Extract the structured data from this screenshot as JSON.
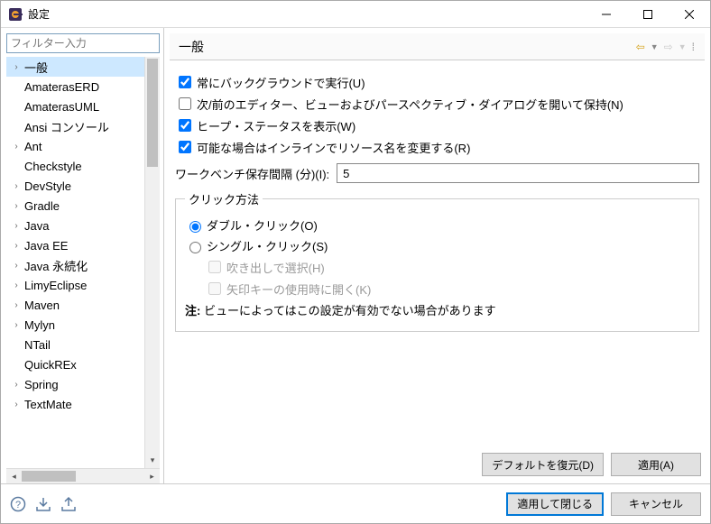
{
  "window": {
    "title": "設定"
  },
  "sidebar": {
    "filter_placeholder": "フィルター入力",
    "items": [
      {
        "label": "一般",
        "expandable": true,
        "selected": true
      },
      {
        "label": "AmaterasERD",
        "expandable": false
      },
      {
        "label": "AmaterasUML",
        "expandable": false
      },
      {
        "label": "Ansi コンソール",
        "expandable": false
      },
      {
        "label": "Ant",
        "expandable": true
      },
      {
        "label": "Checkstyle",
        "expandable": false
      },
      {
        "label": "DevStyle",
        "expandable": true
      },
      {
        "label": "Gradle",
        "expandable": true
      },
      {
        "label": "Java",
        "expandable": true
      },
      {
        "label": "Java EE",
        "expandable": true
      },
      {
        "label": "Java 永続化",
        "expandable": true
      },
      {
        "label": "LimyEclipse",
        "expandable": true
      },
      {
        "label": "Maven",
        "expandable": true
      },
      {
        "label": "Mylyn",
        "expandable": true
      },
      {
        "label": "NTail",
        "expandable": false
      },
      {
        "label": "QuickREx",
        "expandable": false
      },
      {
        "label": "Spring",
        "expandable": true
      },
      {
        "label": "TextMate",
        "expandable": true
      }
    ]
  },
  "page": {
    "title": "一般",
    "check_run_bg": "常にバックグラウンドで実行(U)",
    "check_open_prev": "次/前のエディター、ビューおよびパースペクティブ・ダイアログを開いて保持(N)",
    "check_heap": "ヒープ・ステータスを表示(W)",
    "check_inline": "可能な場合はインラインでリソース名を変更する(R)",
    "save_interval_label": "ワークベンチ保存間隔 (分)(I):",
    "save_interval_value": "5",
    "click_group": "クリック方法",
    "radio_double": "ダブル・クリック(O)",
    "radio_single": "シングル・クリック(S)",
    "sub_hover": "吹き出しで選択(H)",
    "sub_arrow": "矢印キーの使用時に開く(K)",
    "note_prefix": "注: ",
    "note_text": "ビューによってはこの設定が有効でない場合があります",
    "btn_restore": "デフォルトを復元(D)",
    "btn_apply": "適用(A)"
  },
  "footer": {
    "btn_apply_close": "適用して閉じる",
    "btn_cancel": "キャンセル"
  }
}
